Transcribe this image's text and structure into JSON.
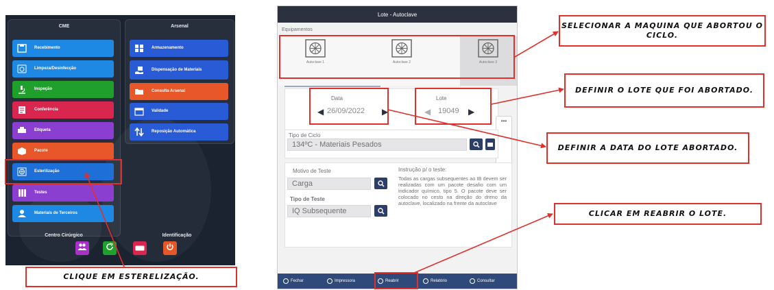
{
  "left_menu": {
    "col_cme_title": "CME",
    "col_arsenal_title": "Arsenal",
    "cme_items": [
      {
        "label": "Recebimento",
        "color": "#1e88e5",
        "icon": "inbox-icon"
      },
      {
        "label": "Limpeza/Desinfecção",
        "color": "#1e88e5",
        "icon": "cleaning-icon"
      },
      {
        "label": "Inspeção",
        "color": "#1fa02c",
        "icon": "microscope-icon"
      },
      {
        "label": "Conferência",
        "color": "#d8264e",
        "icon": "checklist-icon"
      },
      {
        "label": "Etiqueta",
        "color": "#8b3fd1",
        "icon": "printer-icon"
      },
      {
        "label": "Pacote",
        "color": "#e8572a",
        "icon": "package-icon"
      },
      {
        "label": "Esterilização",
        "color": "#1e6fd8",
        "icon": "sterilizer-icon"
      },
      {
        "label": "Testes",
        "color": "#8b3fd1",
        "icon": "test-tubes-icon"
      },
      {
        "label": "Materiais de Terceiros",
        "color": "#1e88e5",
        "icon": "person-icon"
      }
    ],
    "arsenal_items": [
      {
        "label": "Armazenamento",
        "color": "#2a5bd6",
        "icon": "grid-icon"
      },
      {
        "label": "Dispensação de Materiais",
        "color": "#2a5bd6",
        "icon": "hand-package-icon"
      },
      {
        "label": "Consulta Arsenal",
        "color": "#e8572a",
        "icon": "folder-icon"
      },
      {
        "label": "Validade",
        "color": "#2a5bd6",
        "icon": "calendar-icon"
      },
      {
        "label": "Reposição Automática",
        "color": "#2a5bd6",
        "icon": "swap-arrows-icon"
      }
    ],
    "centro_cirurgico_title": "Centro Cirúrgico",
    "identificacao_title": "Identificação",
    "bottom_buttons": [
      {
        "icon": "people-icon",
        "color": "#a832c8"
      },
      {
        "icon": "refresh-icon",
        "color": "#1fa02c"
      },
      {
        "icon": "card-icon",
        "color": "#d8264e"
      },
      {
        "icon": "power-icon",
        "color": "#e8572a"
      }
    ]
  },
  "app": {
    "title": "Lote - Autoclave",
    "equipamentos_label": "Equipamentos",
    "machines": [
      {
        "label": "Autoclave 1",
        "selected": false
      },
      {
        "label": "Autoclave 2",
        "selected": false
      },
      {
        "label": "Autoclave 3",
        "selected": true
      }
    ],
    "data_label": "Data",
    "data_value": "26/09/2022",
    "lote_label": "Lote",
    "lote_value": "19049",
    "more_label": "•••",
    "tipo_ciclo_label": "Tipo de Ciclo",
    "tipo_ciclo_value": "134ºC - Materiais Pesados",
    "motivo_label": "Motivo de Teste",
    "motivo_value": "Carga",
    "tipo_teste_label": "Tipo de Teste",
    "tipo_teste_value": "IQ Subsequente",
    "instrucao_label": "Instrução p/ o teste:",
    "instrucao_text": "Todas as cargas subsequentes ao IB devem ser realizadas com um pacote desafio com um indicador químico, tipo 5. O pacote deve ser colocado no cesto na direção do dreno da autoclave, localizado na frente da autoclave",
    "bottom_buttons": [
      {
        "label": "Fechar"
      },
      {
        "label": "Impressora"
      },
      {
        "label": "Reabrir"
      },
      {
        "label": "Relatório"
      },
      {
        "label": "Consultar"
      }
    ]
  },
  "callouts": {
    "select_machine": "SELECIONAR A MAQUINA QUE ABORTOU O CICLO.",
    "define_lote": "DEFINIR O LOTE QUE FOI ABORTADO.",
    "define_data": "DEFINIR A DATA DO LOTE ABORTADO.",
    "reopen": "CLICAR EM REABRIR O LOTE.",
    "click_sterilization": "CLIQUE EM ESTERELIZAÇÃO."
  },
  "colors": {
    "callout_red": "#e0302b",
    "app_dark": "#2c3140",
    "app_navy": "#2c3e68",
    "bottom_bar": "#2f4a7a"
  }
}
